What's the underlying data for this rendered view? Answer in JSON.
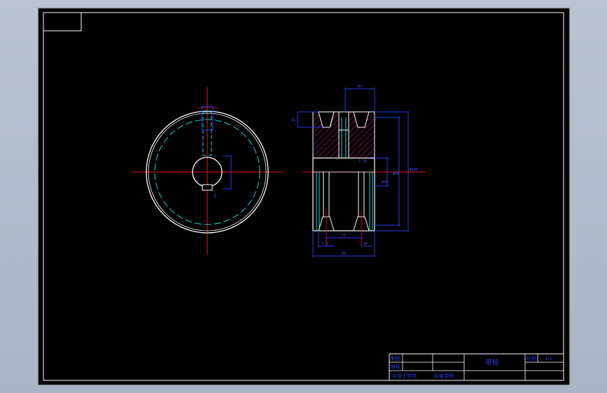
{
  "title_block": {
    "part_name": "带轮",
    "scale_label": "比例",
    "scale_value": "1:1",
    "row1_label": "制图",
    "row2_label": "审核",
    "school": "中原工学院",
    "department": "机电学院"
  },
  "dimensions": {
    "top_width": "40",
    "groove_pitch": "15",
    "groove_depth": "11",
    "hub_dia": "Φ80",
    "outer_dia": "Φ140",
    "bore_dia": "Φ40",
    "left_small": "7.5",
    "bottom_inner": "60",
    "bottom_total": "80",
    "slope": "1:10"
  },
  "colors": {
    "frame_outer": "#0a0a0a",
    "sheet_bg": "#000000",
    "line_white": "#ffffff",
    "center_red": "#e8141b",
    "hidden_cyan": "#19d3d3",
    "dim_blue": "#2a3df0",
    "hatch_magenta": "#c51e8f"
  }
}
